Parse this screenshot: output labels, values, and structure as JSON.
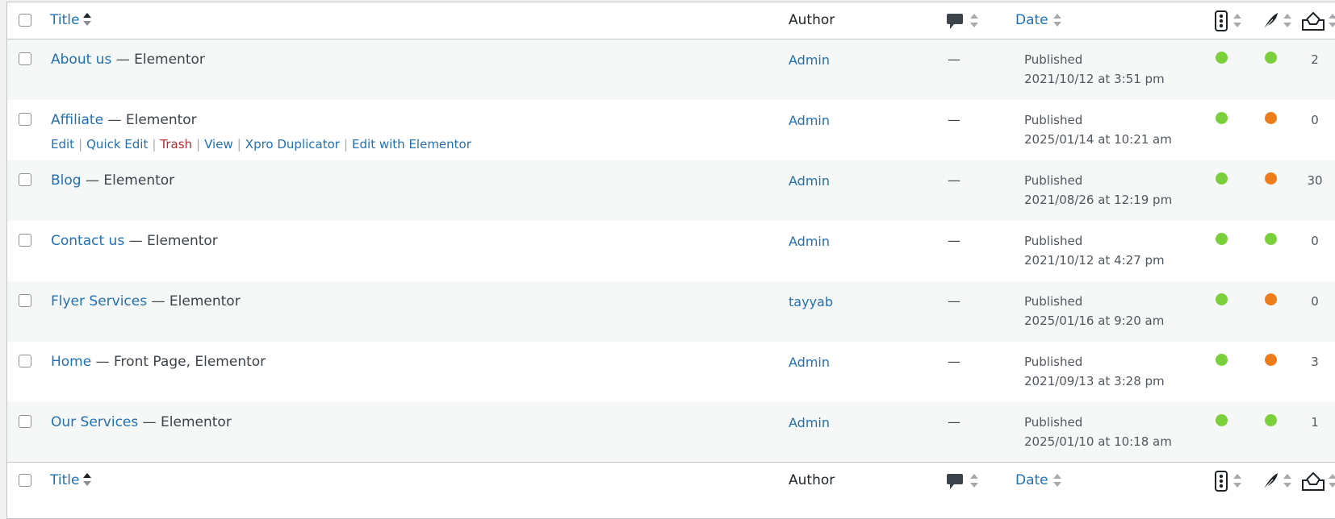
{
  "header": {
    "title_label": "Title",
    "author_label": "Author",
    "date_label": "Date"
  },
  "footer": {
    "title_label": "Title",
    "author_label": "Author",
    "date_label": "Date"
  },
  "colors": {
    "link": "#2271b1",
    "trash": "#b32d2e",
    "green": "#7ad03a",
    "orange": "#ee7c1b"
  },
  "icons": {
    "comments_column": "comment-bubble-icon",
    "seo_column": "traffic-light-icon",
    "readability_column": "feather-icon",
    "links_column": "inbox-links-icon"
  },
  "rows": [
    {
      "title": "About us",
      "state": " — Elementor",
      "author": "Admin",
      "comments": "—",
      "status": "Published",
      "date": "2021/10/12 at 3:51 pm",
      "seo": "green",
      "readability": "green",
      "links": "2"
    },
    {
      "title": "Affiliate",
      "state": " — Elementor",
      "author": "Admin",
      "comments": "—",
      "status": "Published",
      "date": "2025/01/14 at 10:21 am",
      "seo": "green",
      "readability": "orange",
      "links": "0"
    },
    {
      "title": "Blog",
      "state": " — Elementor",
      "author": "Admin",
      "comments": "—",
      "status": "Published",
      "date": "2021/08/26 at 12:19 pm",
      "seo": "green",
      "readability": "orange",
      "links": "30"
    },
    {
      "title": "Contact us",
      "state": " — Elementor",
      "author": "Admin",
      "comments": "—",
      "status": "Published",
      "date": "2021/10/12 at 4:27 pm",
      "seo": "green",
      "readability": "green",
      "links": "0"
    },
    {
      "title": "Flyer Services",
      "state": " — Elementor",
      "author": "tayyab",
      "comments": "—",
      "status": "Published",
      "date": "2025/01/16 at 9:20 am",
      "seo": "green",
      "readability": "orange",
      "links": "0"
    },
    {
      "title": "Home",
      "state": " — Front Page, Elementor",
      "author": "Admin",
      "comments": "—",
      "status": "Published",
      "date": "2021/09/13 at 3:28 pm",
      "seo": "green",
      "readability": "orange",
      "links": "3"
    },
    {
      "title": "Our Services",
      "state": " — Elementor",
      "author": "Admin",
      "comments": "—",
      "status": "Published",
      "date": "2025/01/10 at 10:18 am",
      "seo": "green",
      "readability": "green",
      "links": "1"
    }
  ],
  "row_actions": {
    "edit": "Edit",
    "quick_edit": "Quick Edit",
    "trash": "Trash",
    "view": "View",
    "duplicate": "Xpro Duplicator",
    "elementor": "Edit with Elementor",
    "separator": "|"
  }
}
